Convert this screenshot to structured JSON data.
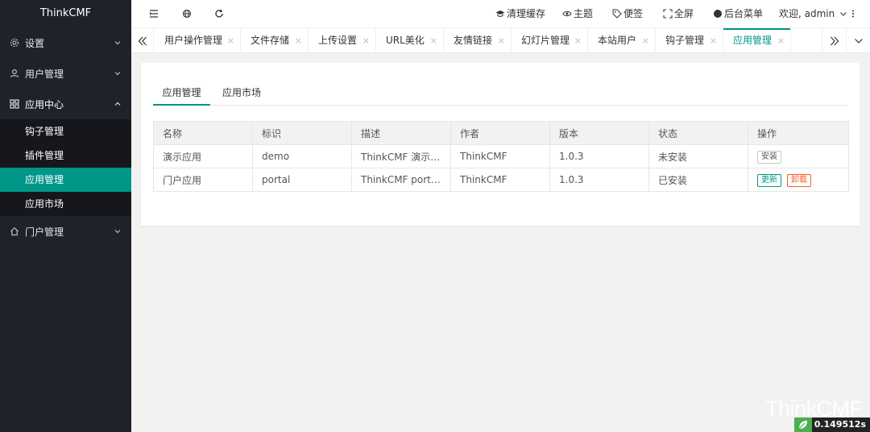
{
  "sidebar": {
    "logo": "ThinkCMF",
    "settings": "设置",
    "users": "用户管理",
    "app_center": "应用中心",
    "sub_items": [
      "钩子管理",
      "插件管理",
      "应用管理",
      "应用市场"
    ],
    "portal": "门户管理"
  },
  "header": {
    "clear_cache": "清理缓存",
    "theme": "主题",
    "notes": "便签",
    "fullscreen": "全屏",
    "admin_menu": "后台菜单",
    "welcome": "欢迎, admin"
  },
  "tabs": [
    "用户操作管理",
    "文件存储",
    "上传设置",
    "URL美化",
    "友情链接",
    "幻灯片管理",
    "本站用户",
    "钩子管理",
    "应用管理"
  ],
  "tab_close": "×",
  "content_tabs": [
    "应用管理",
    "应用市场"
  ],
  "table": {
    "headers": [
      "名称",
      "标识",
      "描述",
      "作者",
      "版本",
      "状态",
      "操作"
    ],
    "rows": [
      {
        "name": "演示应用",
        "id": "demo",
        "desc": "ThinkCMF 演示应用",
        "author": "ThinkCMF",
        "version": "1.0.3",
        "status": "未安装",
        "actions": [
          "安装"
        ]
      },
      {
        "name": "门户应用",
        "id": "portal",
        "desc": "ThinkCMF portal...",
        "author": "ThinkCMF",
        "version": "1.0.3",
        "status": "已安装",
        "actions": [
          "更新",
          "卸载"
        ]
      }
    ]
  },
  "watermark": "ThinkCMF",
  "debug_time": "0.149512s",
  "colors": {
    "accent": "#009688",
    "danger": "#ff5722",
    "sidebar": "#20222a"
  }
}
